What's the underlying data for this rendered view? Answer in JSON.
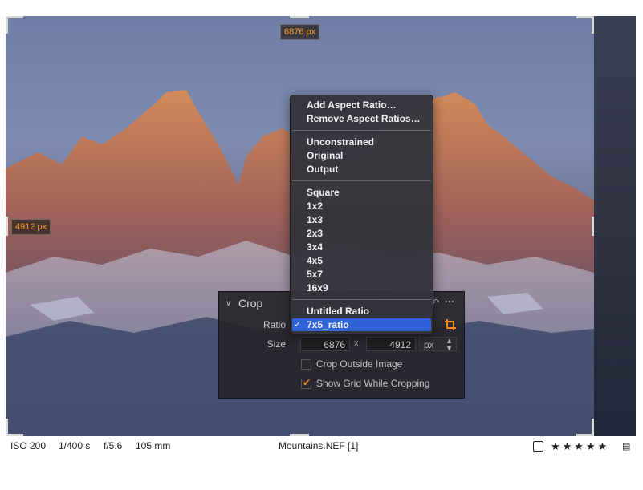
{
  "photo": {
    "width_label": "6876 px",
    "height_label": "4912 px"
  },
  "menu": {
    "group1": [
      "Add Aspect Ratio…",
      "Remove Aspect Ratios…"
    ],
    "group2": [
      "Unconstrained",
      "Original",
      "Output"
    ],
    "group3": [
      "Square",
      "1x2",
      "1x3",
      "2x3",
      "3x4",
      "4x5",
      "5x7",
      "16x9"
    ],
    "group4": [
      "Untitled Ratio",
      "7x5_ratio"
    ],
    "selected": "7x5_ratio",
    "check_glyph": "✓"
  },
  "crop": {
    "title": "Crop",
    "ratio_label": "Ratio",
    "size_label": "Size",
    "width": "6876",
    "x_sep": "x",
    "height": "4912",
    "unit": "px",
    "crop_outside": {
      "label": "Crop Outside Image",
      "checked": false
    },
    "show_grid": {
      "label": "Show Grid While Cropping",
      "checked": true
    },
    "more_glyph": "···",
    "reset_glyph": "↶"
  },
  "status": {
    "iso": "ISO 200",
    "shutter": "1/400 s",
    "aperture": "f/5.6",
    "focal": "105 mm",
    "filename": "Mountains.NEF [1]",
    "stars": "★★★★★",
    "rating": 5
  },
  "colors": {
    "accent": "#ff8a1a",
    "selection": "#2f62d8"
  }
}
